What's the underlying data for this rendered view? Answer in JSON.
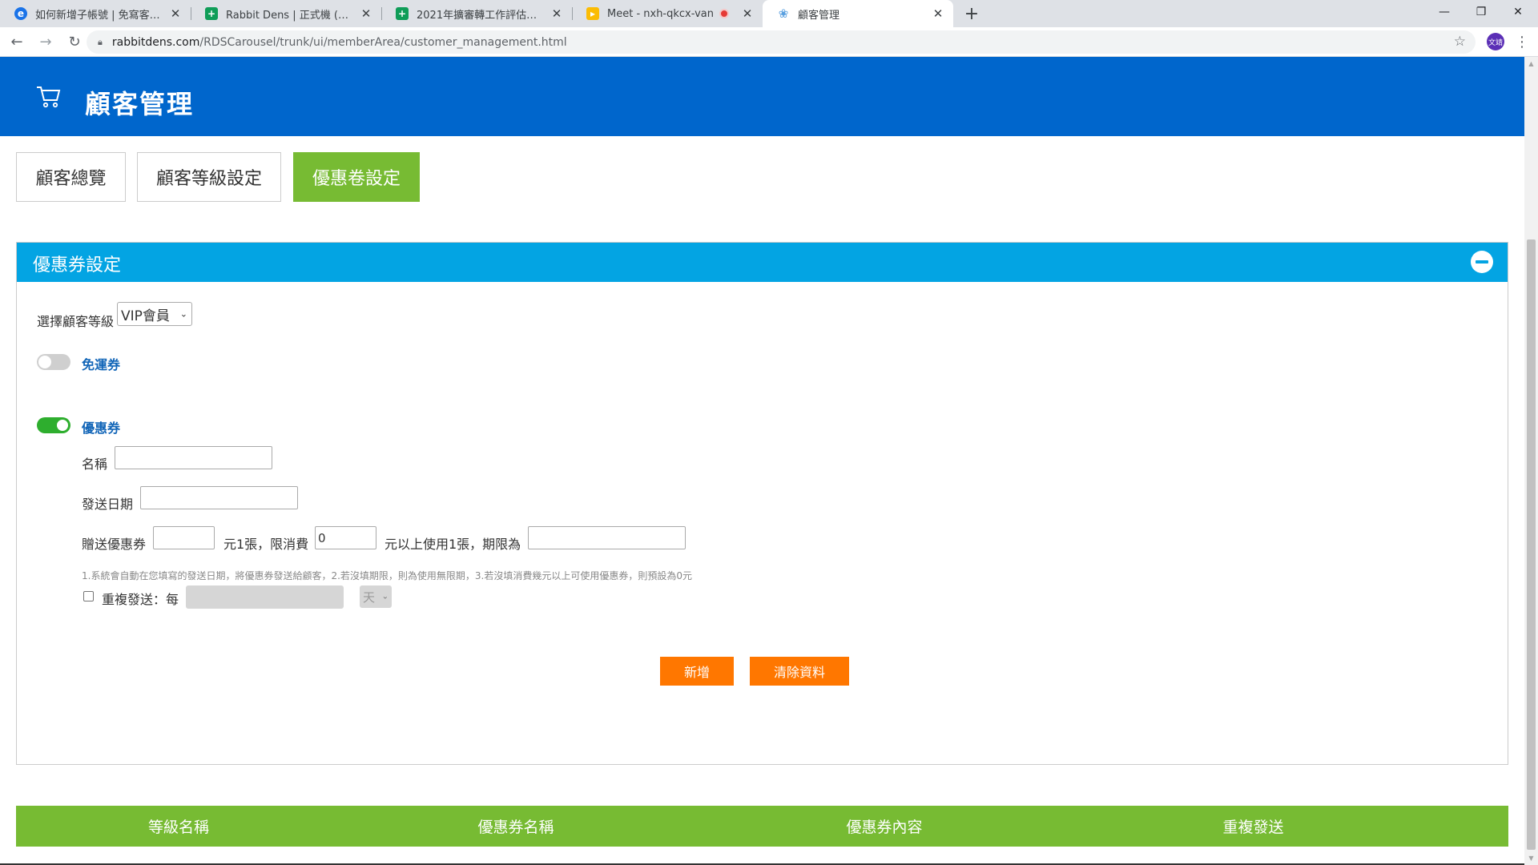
{
  "browser": {
    "tabs": [
      {
        "title": "如何新增子帳號 | 免寫客服中心",
        "icon": "edge-icon",
        "active": false
      },
      {
        "title": "Rabbit Dens | 正式機 (2021) - G",
        "icon": "sheets-icon",
        "active": false
      },
      {
        "title": "2021年擴審轉工作評估表-kun -",
        "icon": "sheets-icon",
        "active": false
      },
      {
        "title": "Meet - nxh-qkcx-van",
        "icon": "meet-icon",
        "active": false,
        "recording": true
      },
      {
        "title": "顧客管理",
        "icon": "rabbit-icon",
        "active": true
      }
    ],
    "url_host": "rabbitdens.com",
    "url_path": "/RDSCarousel/trunk/ui/memberArea/customer_management.html",
    "profile_initials": "文靖"
  },
  "header": {
    "title": "顧客管理",
    "icon": "cart-icon"
  },
  "tabs": [
    {
      "label": "顧客總覽",
      "active": false
    },
    {
      "label": "顧客等級設定",
      "active": false
    },
    {
      "label": "優惠卷設定",
      "active": true
    }
  ],
  "panel": {
    "title": "優惠券設定",
    "level_label": "選擇顧客等級",
    "level_value": "VIP會員",
    "free_shipping": {
      "label": "免運券",
      "enabled": false
    },
    "coupon": {
      "label": "優惠券",
      "enabled": true,
      "name_label": "名稱",
      "name_value": "",
      "date_label": "發送日期",
      "date_value": "",
      "gift_label": "贈送優惠券",
      "gift_amount": "",
      "per_label": "元1張，限消費",
      "min_spend": "0",
      "valid_label": "元以上使用1張，期限為",
      "valid_value": "",
      "note": "1.系統會自動在您填寫的發送日期，將優惠券發送給顧客，2.若沒填期限，則為使用無限期，3.若沒填消費幾元以上可使用優惠券，則預設為0元",
      "repeat_label": "重複發送：每",
      "repeat_checked": false,
      "repeat_value": "",
      "repeat_unit": "天"
    },
    "add_button": "新增",
    "clear_button": "清除資料"
  },
  "table": {
    "headers": [
      "等級名稱",
      "優惠券名稱",
      "優惠券內容",
      "重複發送"
    ]
  },
  "colors": {
    "banner": "#0066cc",
    "panel_header": "#03a4e3",
    "active_tab": "#77bb33",
    "button": "#ff7700",
    "toggle_on": "#2eae2e"
  }
}
